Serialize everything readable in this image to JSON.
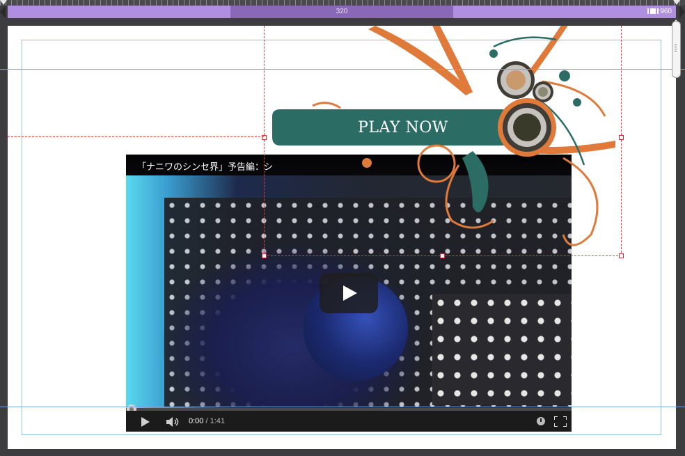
{
  "breakpoints": {
    "active_label": "320",
    "max_label": "960"
  },
  "video": {
    "title": "「ナニワのシンセ界」予告編：シ",
    "current_time": "0:00",
    "separator": " / ",
    "duration": "1:41",
    "progress": 0
  },
  "graphic": {
    "play_now_label": "PLAY NOW"
  },
  "icons": {
    "play": "play-icon",
    "volume": "volume-icon",
    "watch_later": "clock-icon",
    "fullscreen": "fullscreen-icon"
  },
  "colors": {
    "breakpoint_bar": "#b08ee0",
    "breakpoint_active": "#8a68b8",
    "banner_teal": "#2b6d64",
    "splash_orange": "#e07a3a",
    "guide_blue": "#8fc3dd",
    "selection_red": "#e04040"
  }
}
